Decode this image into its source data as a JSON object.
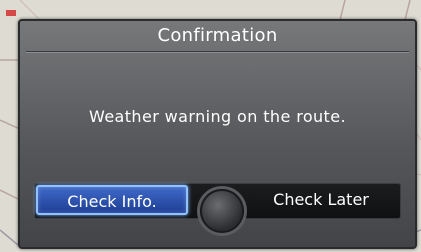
{
  "dialog": {
    "title": "Confirmation",
    "message": "Weather warning on the route."
  },
  "buttons": {
    "check_info": "Check Info.",
    "check_later": "Check Later"
  },
  "map": {
    "corner_label": "MENU"
  },
  "colors": {
    "dialog_bg": "#5a5c5f",
    "selected_button": "#2d52b0",
    "selected_border": "#8ec3ff",
    "text": "#ffffff"
  }
}
